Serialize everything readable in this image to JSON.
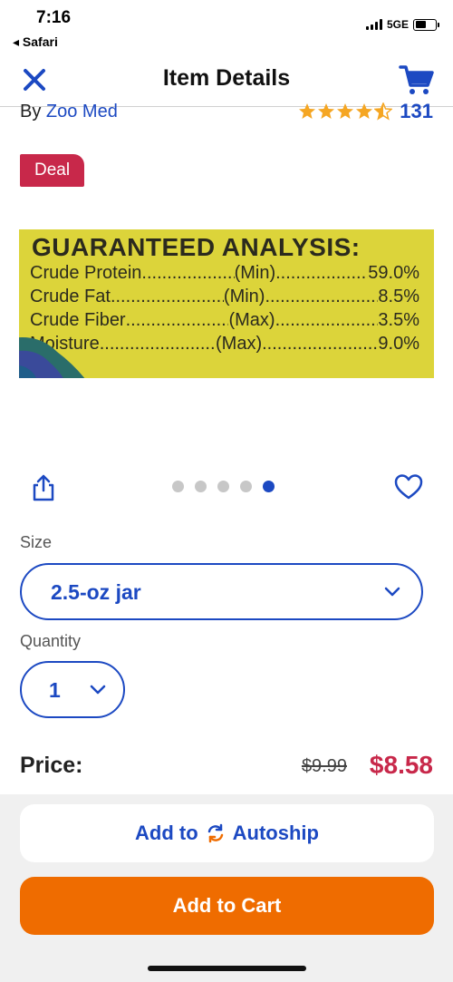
{
  "status_bar": {
    "time": "7:16",
    "back_app": "Safari",
    "network": "5GE"
  },
  "nav": {
    "title": "Item Details",
    "close_icon": "close-icon",
    "cart_icon": "cart-icon"
  },
  "product": {
    "by_prefix": "By",
    "brand": "Zoo Med",
    "rating": 4.5,
    "review_count": "131",
    "badge": "Deal",
    "image": {
      "title": "GUARANTEED ANALYSIS:",
      "rows": [
        {
          "label": "Crude Protein",
          "basis": "(Min)",
          "value": "59.0%"
        },
        {
          "label": "Crude Fat",
          "basis": "(Min)",
          "value": "8.5%"
        },
        {
          "label": "Crude Fiber",
          "basis": "(Max)",
          "value": "3.5%"
        },
        {
          "label": "Moisture",
          "basis": "(Max)",
          "value": "9.0%"
        }
      ]
    },
    "carousel": {
      "count": 5,
      "active_index": 4
    }
  },
  "options": {
    "size_label": "Size",
    "size_value": "2.5-oz jar",
    "quantity_label": "Quantity",
    "quantity_value": "1"
  },
  "price": {
    "label": "Price:",
    "original": "$9.99",
    "sale": "$8.58"
  },
  "actions": {
    "autoship_prefix": "Add to",
    "autoship_label": "Autoship",
    "add_to_cart": "Add to Cart"
  },
  "colors": {
    "brand_blue": "#1c49c2",
    "deal_red": "#c8284a",
    "cart_orange": "#ef6c00",
    "star_gold": "#f5a623"
  }
}
